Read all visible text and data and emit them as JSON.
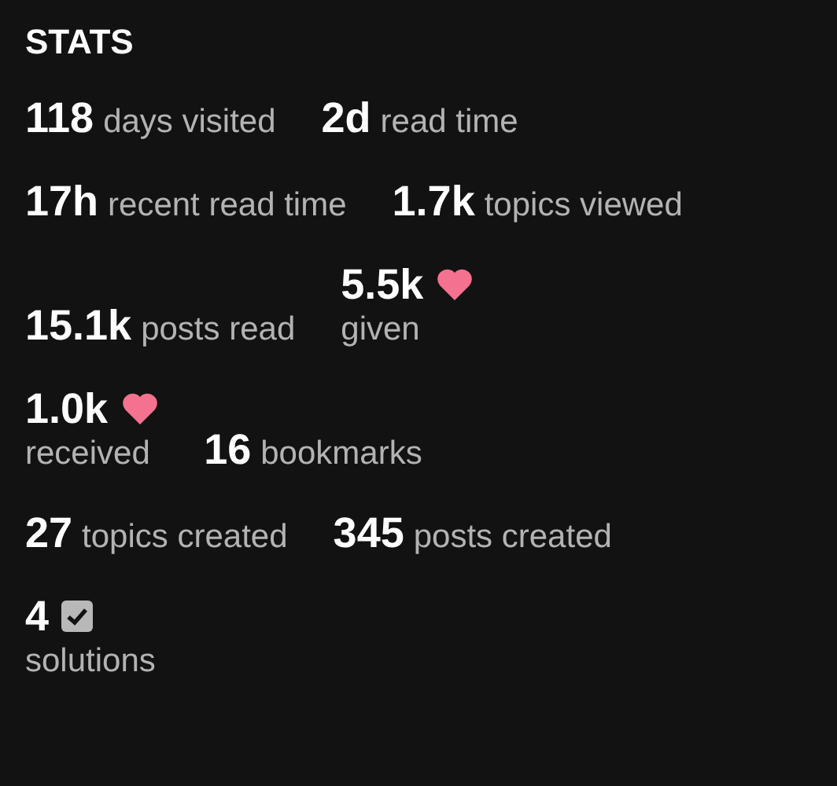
{
  "title": "STATS",
  "rows": [
    [
      {
        "kind": "inline",
        "count": "118",
        "caption": "days visited"
      },
      {
        "kind": "inline",
        "count": "2d",
        "caption": "read time"
      }
    ],
    [
      {
        "kind": "inline",
        "count": "17h",
        "caption": "recent read time"
      },
      {
        "kind": "inline",
        "count": "1.7k",
        "caption": "topics viewed"
      }
    ],
    [
      {
        "kind": "inline",
        "count": "15.1k",
        "caption": "posts read"
      },
      {
        "kind": "liked",
        "count": "5.5k",
        "caption": "given"
      }
    ],
    [
      {
        "kind": "liked",
        "count": "1.0k",
        "caption": "received"
      },
      {
        "kind": "inline",
        "count": "16",
        "caption": "bookmarks"
      }
    ],
    [
      {
        "kind": "inline",
        "count": "27",
        "caption": "topics created"
      },
      {
        "kind": "inline",
        "count": "345",
        "caption": "posts created"
      }
    ],
    [
      {
        "kind": "solved",
        "count": "4",
        "caption": "solutions"
      }
    ]
  ]
}
